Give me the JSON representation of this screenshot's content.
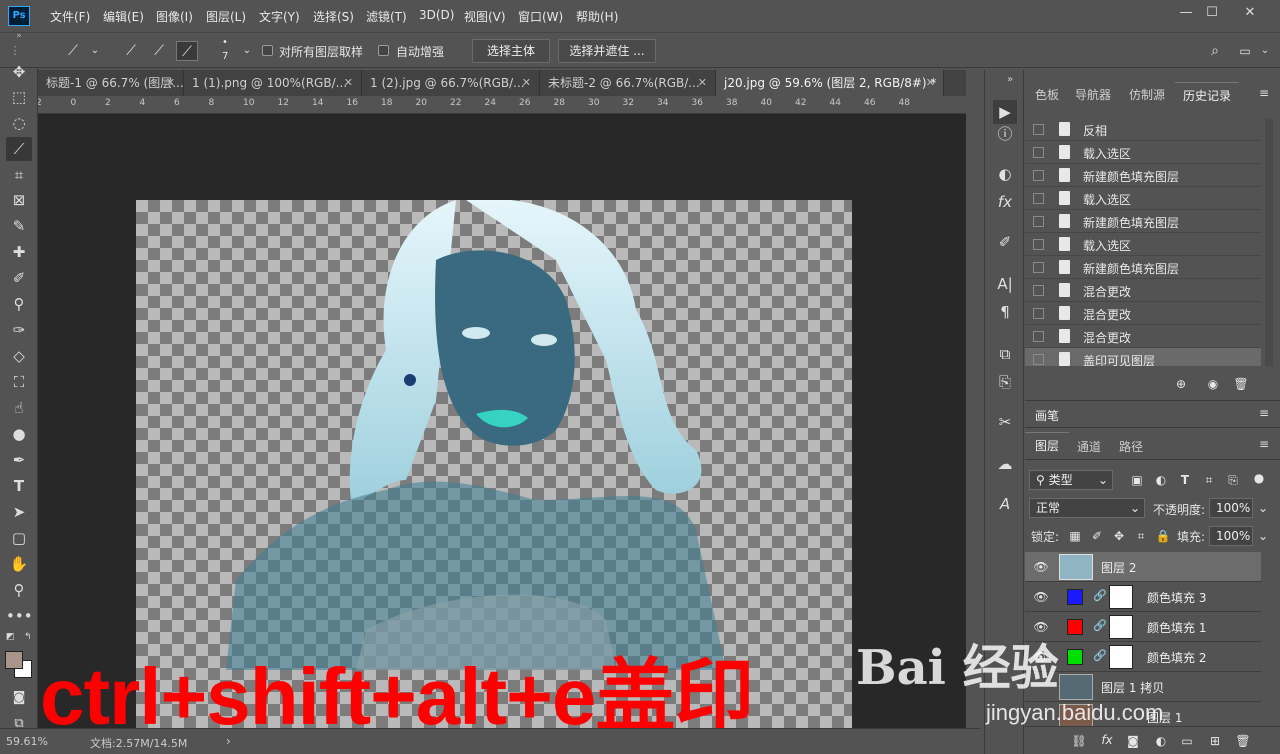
{
  "app": {
    "logo": "Ps"
  },
  "menu": [
    "文件(F)",
    "编辑(E)",
    "图像(I)",
    "图层(L)",
    "文字(Y)",
    "选择(S)",
    "滤镜(T)",
    "3D(D)",
    "视图(V)",
    "窗口(W)",
    "帮助(H)"
  ],
  "window_controls": [
    "—",
    "☐",
    "✕"
  ],
  "options": {
    "brush_size": "7",
    "sample_all_layers": "对所有图层取样",
    "auto_enhance": "自动增强",
    "select_subject": "选择主体",
    "select_and_mask": "选择并遮住 ..."
  },
  "tabs": [
    {
      "label": "标题-1 @ 66.7% (图层...",
      "close": "✕"
    },
    {
      "label": "1 (1).png @ 100%(RGB/...",
      "close": "✕"
    },
    {
      "label": "1 (2).jpg @ 66.7%(RGB/...",
      "close": "✕"
    },
    {
      "label": "未标题-2 @ 66.7%(RGB/...",
      "close": "✕"
    },
    {
      "label": "j20.jpg @ 59.6% (图层 2, RGB/8#) *",
      "close": "✕"
    }
  ],
  "ruler_ticks": [
    "2",
    "0",
    "2",
    "4",
    "6",
    "8",
    "10",
    "12",
    "14",
    "16",
    "18",
    "20",
    "22",
    "24",
    "26",
    "28",
    "30",
    "32",
    "34",
    "36",
    "38",
    "40",
    "42",
    "44",
    "46",
    "48"
  ],
  "overlay_text": {
    "shortcut": "ctrl+shift+alt+e",
    "cn": "盖印"
  },
  "status": {
    "zoom": "59.61%",
    "doc": "文档:2.57M/14.5M",
    "arrow": "›"
  },
  "panel_top_tabs": [
    "色板",
    "导航器",
    "仿制源",
    "历史记录"
  ],
  "history": {
    "items": [
      "反相",
      "载入选区",
      "新建颜色填充图层",
      "载入选区",
      "新建颜色填充图层",
      "载入选区",
      "新建颜色填充图层",
      "混合更改",
      "混合更改",
      "混合更改",
      "盖印可见图层"
    ],
    "selected_index": 10
  },
  "brush_panel": {
    "title": "画笔"
  },
  "layers_panel": {
    "tabs": [
      "图层",
      "通道",
      "路径"
    ],
    "filter": "类型",
    "blend_mode": "正常",
    "opacity_label": "不透明度:",
    "opacity": "100%",
    "lock_label": "锁定:",
    "fill_label": "填充:",
    "fill": "100%",
    "layers": [
      {
        "name": "图层 2",
        "selected": true
      },
      {
        "name": "颜色填充 3",
        "color": "#1a1aff"
      },
      {
        "name": "颜色填充 1",
        "color": "#ff0000"
      },
      {
        "name": "颜色填充 2",
        "color": "#00e000"
      },
      {
        "name": "图层 1 拷贝"
      },
      {
        "name": "图层 1"
      }
    ]
  },
  "watermark": {
    "cn": "Bai 经验",
    "url": "jingyan.baidu.com"
  }
}
